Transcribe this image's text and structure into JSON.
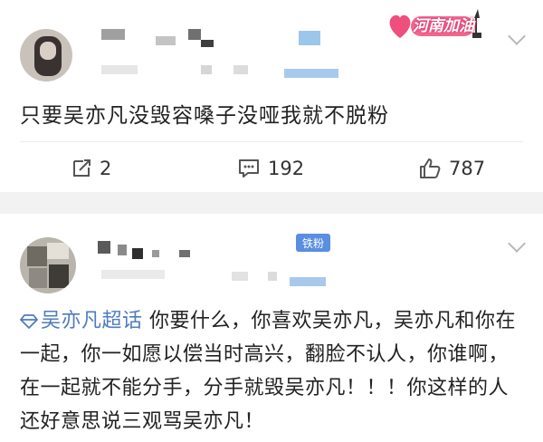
{
  "post1": {
    "text": "只要吴亦凡没毁容嗓子没哑我就不脱粉",
    "badge": "河南加油",
    "repost_count": "2",
    "comment_count": "192",
    "like_count": "787"
  },
  "post2": {
    "fan_badge": "铁粉",
    "topic": "吴亦凡超话",
    "text": "你要什么，你喜欢吴亦凡，吴亦凡和你在一起，你一如愿以偿当时高兴，翻脸不认人，你谁啊，在一起就不能分手，分手就毁吴亦凡！！！你这样的人还好意思说三观骂吴亦凡！"
  },
  "colors": {
    "accent": "#4f7cc0",
    "badge_pink": "#ef4f7d",
    "fan_badge": "#5b8de0"
  }
}
